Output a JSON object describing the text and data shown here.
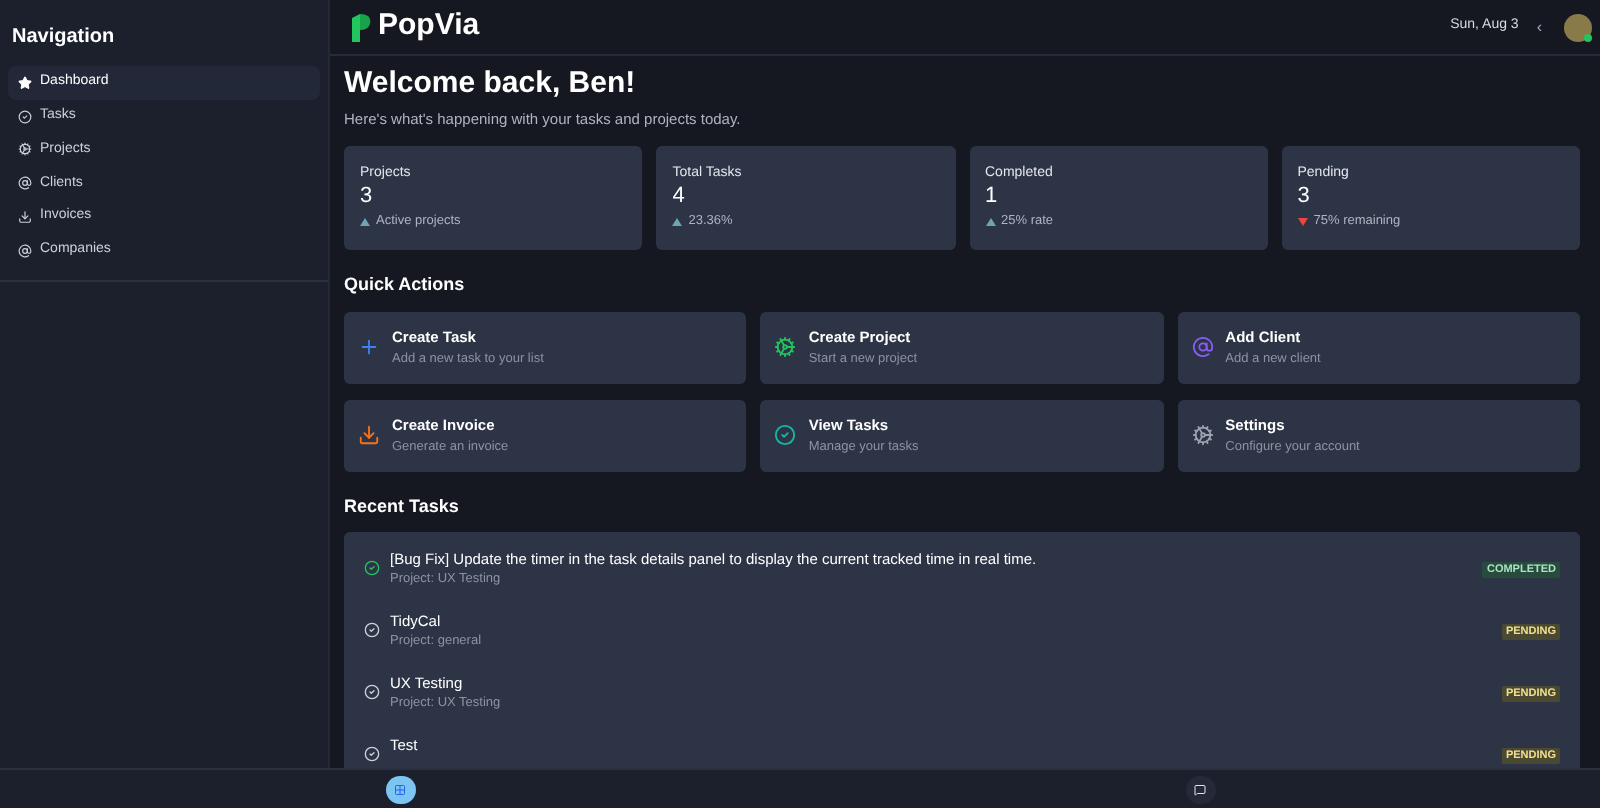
{
  "sidebar": {
    "title": "Navigation",
    "items": [
      {
        "label": "Dashboard",
        "selected": true
      },
      {
        "label": "Tasks",
        "selected": false
      },
      {
        "label": "Projects",
        "selected": false
      },
      {
        "label": "Clients",
        "selected": false
      },
      {
        "label": "Invoices",
        "selected": false
      },
      {
        "label": "Companies",
        "selected": false
      }
    ]
  },
  "header": {
    "logo": "PopVia",
    "date": "Sun, Aug 3",
    "caret": "‹"
  },
  "welcome": {
    "title": "Welcome back, Ben!",
    "subtitle": "Here's what's happening with your tasks and projects today."
  },
  "stats": [
    {
      "label": "Projects",
      "value": "3",
      "kind": "up",
      "note": "Active projects"
    },
    {
      "label": "Total Tasks",
      "value": "4",
      "kind": "up",
      "note": "23.36%"
    },
    {
      "label": "Completed",
      "value": "1",
      "kind": "up",
      "note": "25% rate"
    },
    {
      "label": "Pending",
      "value": "3",
      "kind": "down",
      "note": "75% remaining"
    }
  ],
  "quick_actions": {
    "title": "Quick Actions",
    "items": [
      {
        "title": "Create Task",
        "subtitle": "Add a new task to your list"
      },
      {
        "title": "Create Project",
        "subtitle": "Start a new project"
      },
      {
        "title": "Add Client",
        "subtitle": "Add a new client"
      },
      {
        "title": "Create Invoice",
        "subtitle": "Generate an invoice"
      },
      {
        "title": "View Tasks",
        "subtitle": "Manage your tasks"
      },
      {
        "title": "Settings",
        "subtitle": "Configure your account"
      }
    ]
  },
  "recent_tasks": {
    "title": "Recent Tasks",
    "items": [
      {
        "title": "[Bug Fix] Update the timer in the task details panel to display the current tracked time in real time.",
        "project": "Project: UX Testing",
        "status": "COMPLETED",
        "kind": "completed"
      },
      {
        "title": "TidyCal",
        "project": "Project: general",
        "status": "PENDING",
        "kind": "pending"
      },
      {
        "title": "UX Testing",
        "project": "Project: UX Testing",
        "status": "PENDING",
        "kind": "pending"
      },
      {
        "title": "Test",
        "status": "PENDING",
        "kind": "pending"
      }
    ]
  },
  "bottom_bar": [
    {
      "selected": true
    },
    {
      "selected": false
    }
  ]
}
